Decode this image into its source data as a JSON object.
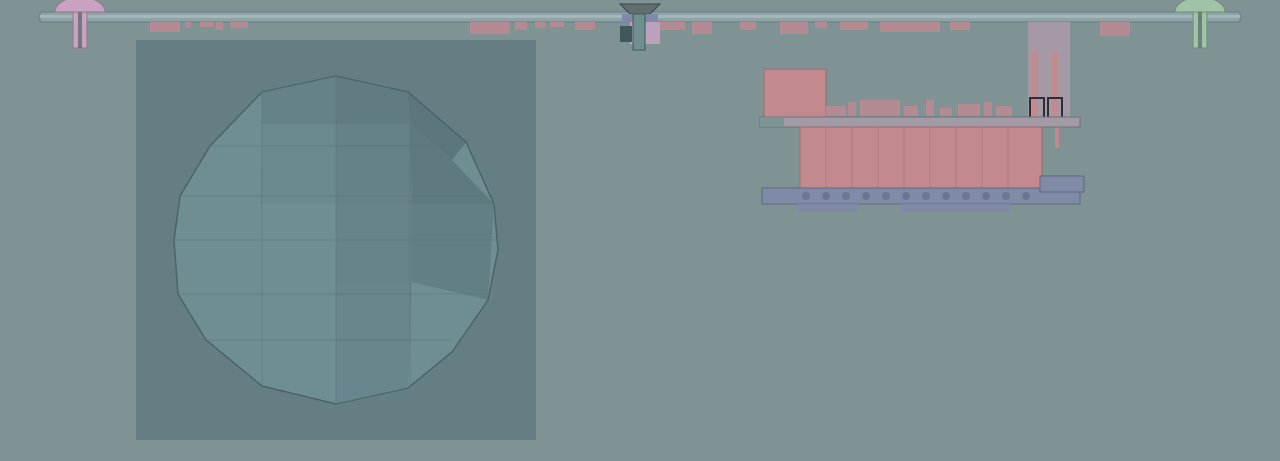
{
  "scene": {
    "background_color": "#7f9294",
    "panel_color": "#657e83",
    "sphere_color": "#6e8e94",
    "board_color": "#c28a8e",
    "component_tint_color": "#b48a92",
    "connector_color": "#7f8aa6",
    "left_standoff_color": "#c8a2c0",
    "right_standoff_color": "#9fc3a7",
    "center_screw_color": "#5f6f70",
    "view": "cad-orthographic-section",
    "text": []
  }
}
